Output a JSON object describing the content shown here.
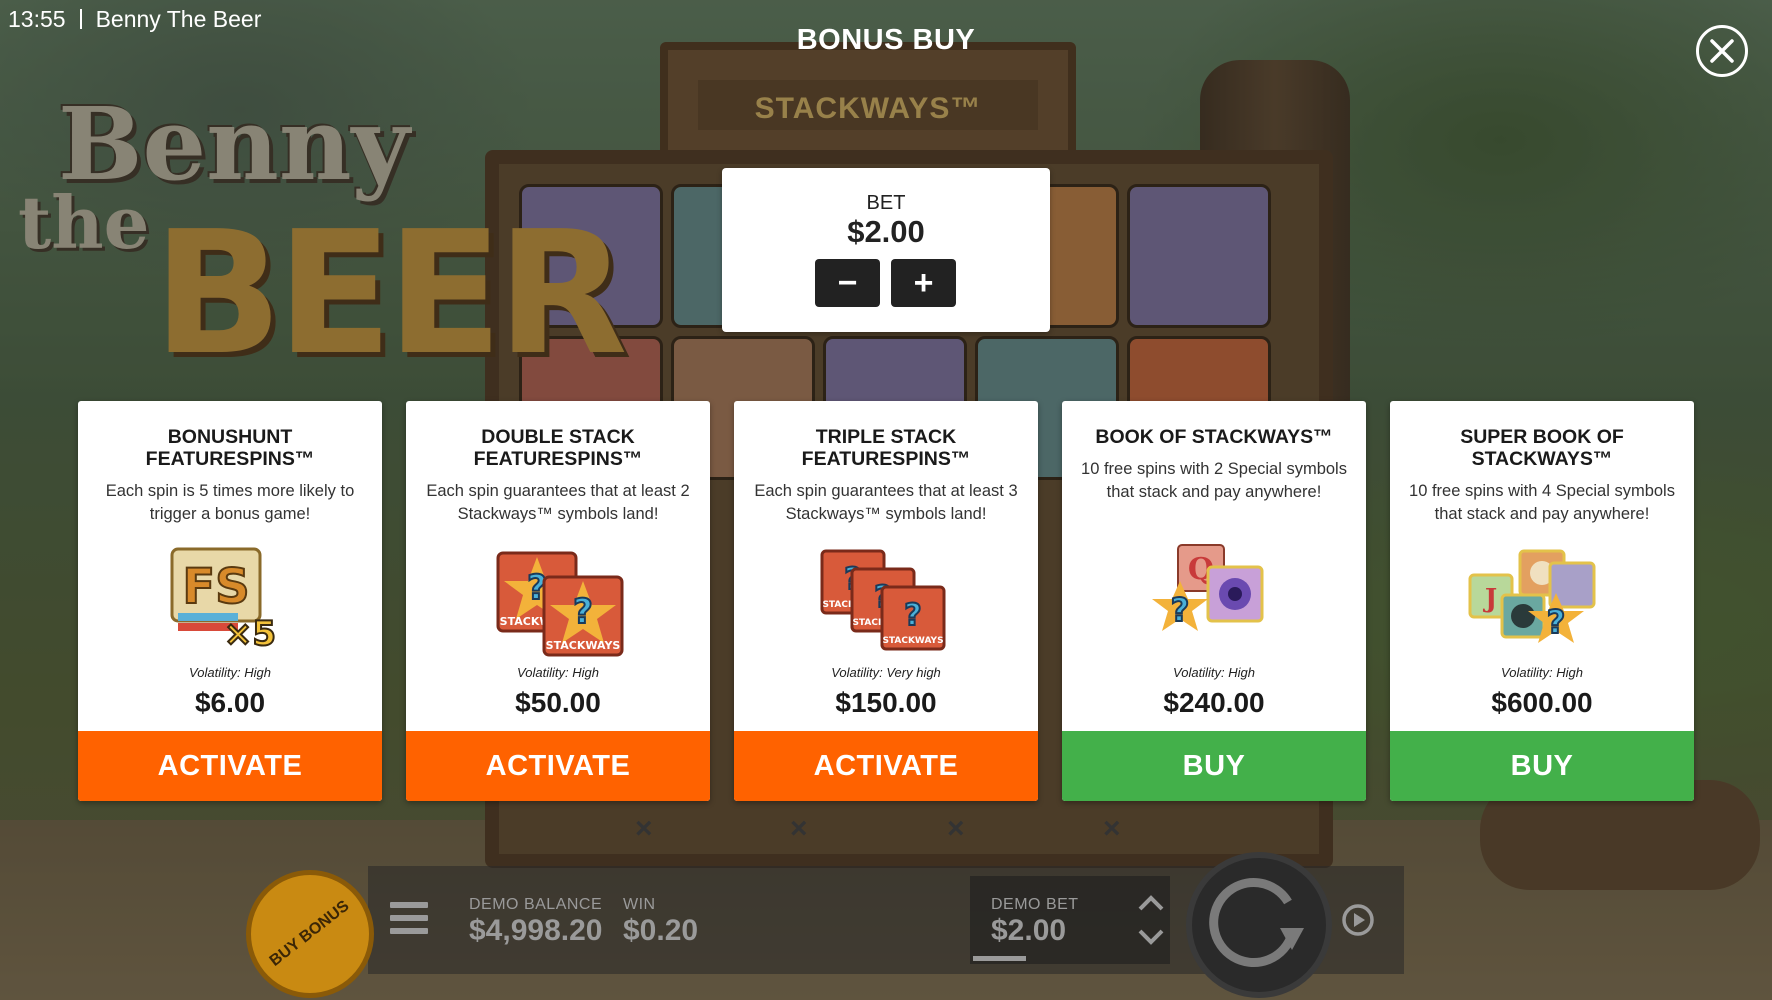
{
  "status_bar": {
    "time": "13:55",
    "app_title": "Benny The Beer"
  },
  "header": {
    "title": "BONUS BUY",
    "close_icon": "close-x"
  },
  "bet_panel": {
    "label": "BET",
    "value": "$2.00",
    "decrease_symbol": "−",
    "increase_symbol": "+"
  },
  "game_logo": {
    "line1": "Benny",
    "line2": "the",
    "line3": "BEER"
  },
  "board_sign": "STACKWAYS™",
  "cards": [
    {
      "title": "BONUSHUNT FEATURESPINS™",
      "description": "Each spin is 5 times more likely to trigger a bonus game!",
      "volatility": "Volatility: High",
      "price": "$6.00",
      "action": "ACTIVATE",
      "art": "fs-x5-symbol"
    },
    {
      "title": "DOUBLE STACK FEATURESPINS™",
      "description": "Each spin guarantees that at least 2 Stackways™ symbols land!",
      "volatility": "Volatility: High",
      "price": "$50.00",
      "action": "ACTIVATE",
      "art": "double-stackways-symbols",
      "art_text": "STACKWAYS"
    },
    {
      "title": "TRIPLE STACK FEATURESPINS™",
      "description": "Each spin guarantees that at least 3 Stackways™ symbols land!",
      "volatility": "Volatility: Very high",
      "price": "$150.00",
      "action": "ACTIVATE",
      "art": "triple-stackways-symbols",
      "art_text": "STACKWAYS"
    },
    {
      "title": "BOOK OF STACKWAYS™",
      "description": "10 free spins with 2 Special symbols that stack and pay anywhere!",
      "volatility": "Volatility: High",
      "price": "$240.00",
      "action": "BUY",
      "art": "special-symbols-2"
    },
    {
      "title": "SUPER BOOK OF STACKWAYS™",
      "description": "10 free spins with 4 Special symbols that stack and pay anywhere!",
      "volatility": "Volatility: High",
      "price": "$600.00",
      "action": "BUY",
      "art": "special-symbols-4"
    }
  ],
  "colors": {
    "activate": "#ff6200",
    "buy": "#43b04a"
  },
  "bottom_bar": {
    "buy_bonus": "BUY BONUS",
    "demo_balance_label": "DEMO BALANCE",
    "demo_balance_value": "$4,998.20",
    "win_label": "WIN",
    "win_value": "$0.20",
    "demo_bet_label": "DEMO BET",
    "demo_bet_value": "$2.00",
    "marks": "×"
  }
}
